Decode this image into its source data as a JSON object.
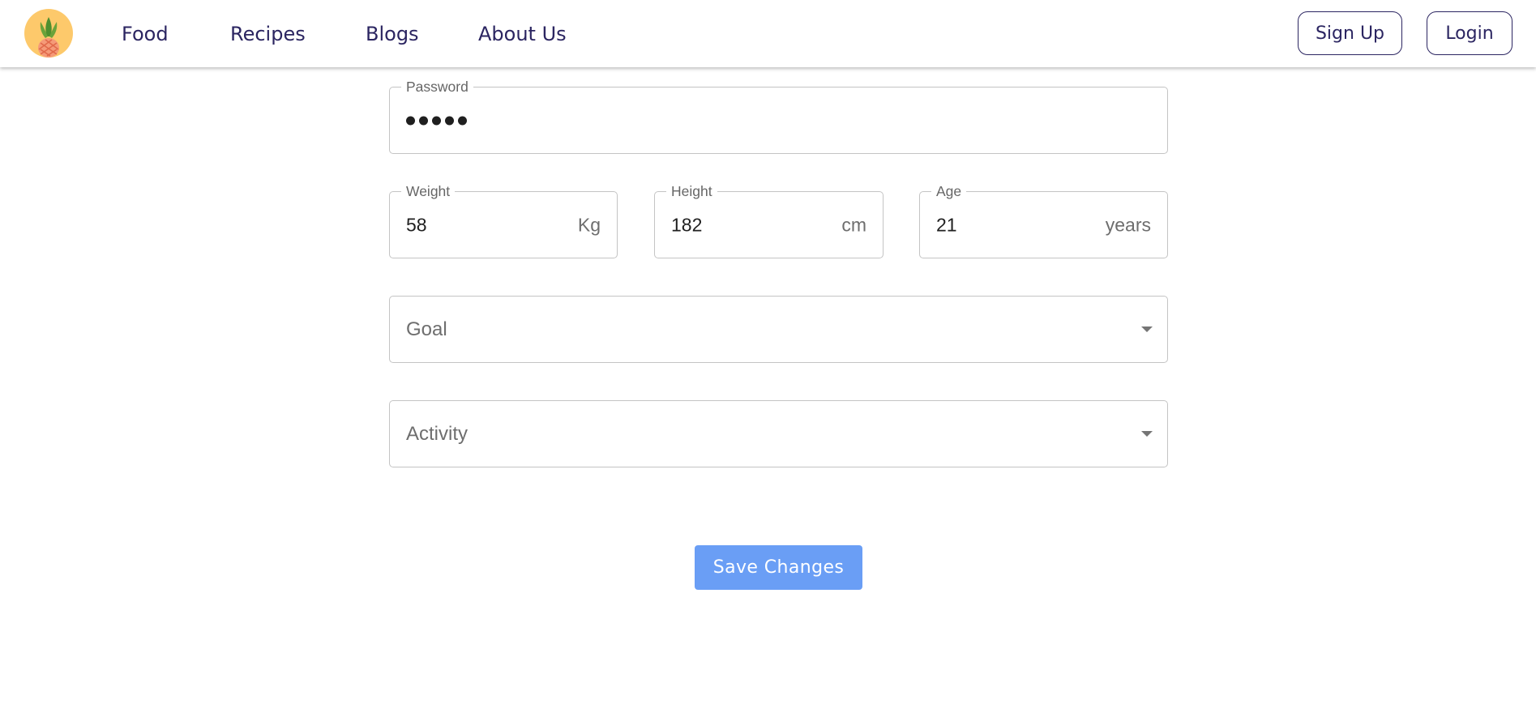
{
  "navbar": {
    "logo_icon": "pineapple-logo-icon",
    "links": [
      {
        "label": "Food"
      },
      {
        "label": "Recipes"
      },
      {
        "label": "Blogs"
      },
      {
        "label": "About Us"
      }
    ],
    "signup_label": "Sign Up",
    "login_label": "Login"
  },
  "form": {
    "password": {
      "label": "Password",
      "masked_length": 5
    },
    "weight": {
      "label": "Weight",
      "value": "58",
      "unit": "Kg"
    },
    "height": {
      "label": "Height",
      "value": "182",
      "unit": "cm"
    },
    "age": {
      "label": "Age",
      "value": "21",
      "unit": "years"
    },
    "goal": {
      "placeholder": "Goal",
      "icon": "dropdown-arrow-icon"
    },
    "activity": {
      "placeholder": "Activity",
      "icon": "dropdown-arrow-icon"
    },
    "save_label": "Save Changes"
  },
  "colors": {
    "brand_text": "#2b2561",
    "logo_bg": "#fdc96b",
    "save_button": "#6a9ef5",
    "field_border": "#c4c4c4"
  }
}
